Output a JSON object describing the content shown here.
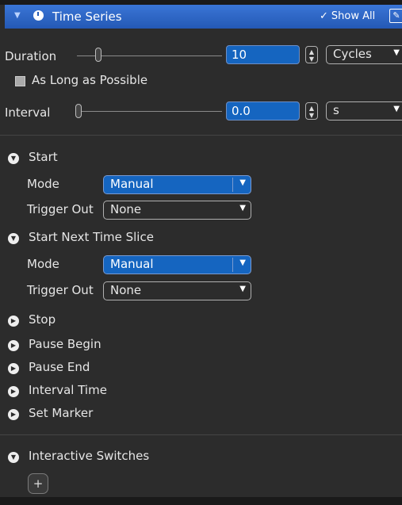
{
  "header": {
    "title": "Time Series",
    "show_all": "Show All",
    "edit_icon": "✎"
  },
  "duration": {
    "label": "Duration",
    "value": "10",
    "unit": "Cycles"
  },
  "as_long_as_possible": {
    "label": "As Long as Possible",
    "checked": false
  },
  "interval": {
    "label": "Interval",
    "value": "0.0",
    "unit": "s"
  },
  "sections": {
    "start": {
      "label": "Start",
      "mode_label": "Mode",
      "mode_value": "Manual",
      "trigger_label": "Trigger Out",
      "trigger_value": "None"
    },
    "start_next": {
      "label": "Start Next Time Slice",
      "mode_label": "Mode",
      "mode_value": "Manual",
      "trigger_label": "Trigger Out",
      "trigger_value": "None"
    },
    "stop": "Stop",
    "pause_begin": "Pause Begin",
    "pause_end": "Pause End",
    "interval_time": "Interval Time",
    "set_marker": "Set Marker",
    "interactive_switches": "Interactive Switches"
  },
  "add_button_label": "+",
  "colors": {
    "header_blue": "#2a62c4",
    "field_blue": "#1565c0",
    "bg": "#2c2c2c"
  },
  "icons": [
    "clock-icon",
    "check-icon",
    "edit-icon",
    "expanded-icon",
    "collapsed-icon",
    "chevron-down-icon",
    "plus-icon"
  ]
}
